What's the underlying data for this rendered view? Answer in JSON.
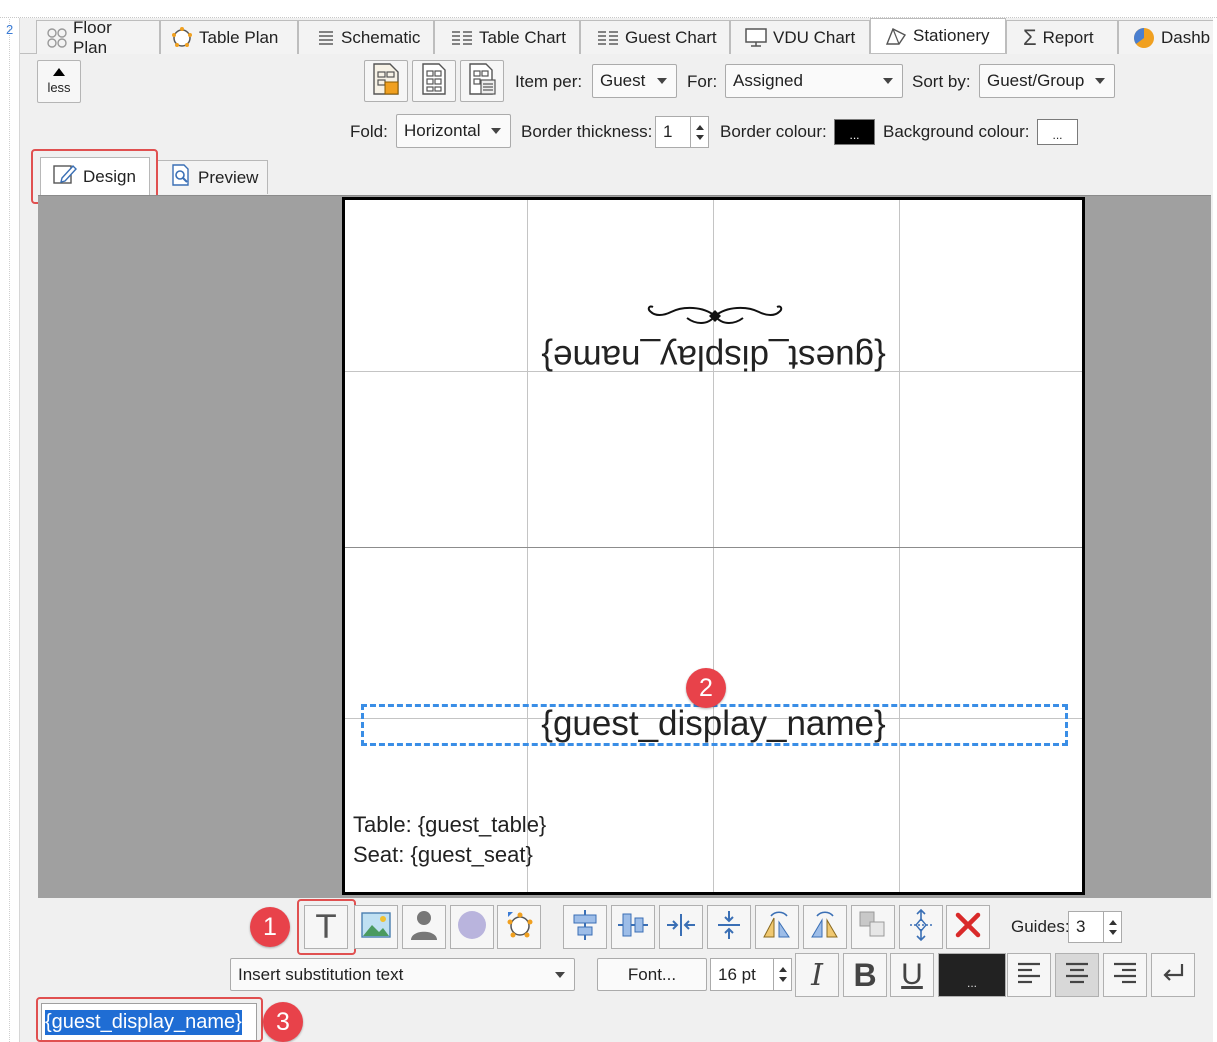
{
  "tabs": [
    {
      "label": "Floor Plan",
      "icon": "floor-plan-icon"
    },
    {
      "label": "Table Plan",
      "icon": "table-plan-icon"
    },
    {
      "label": "Schematic",
      "icon": "schematic-icon"
    },
    {
      "label": "Table Chart",
      "icon": "table-chart-icon"
    },
    {
      "label": "Guest Chart",
      "icon": "guest-chart-icon"
    },
    {
      "label": "VDU Chart",
      "icon": "monitor-icon"
    },
    {
      "label": "Stationery",
      "icon": "stationery-icon",
      "active": true
    },
    {
      "label": "Report",
      "icon": "sigma-icon"
    },
    {
      "label": "Dashb",
      "icon": "pie-icon"
    }
  ],
  "left_edge_text": "2",
  "toolbar": {
    "less_label": "less",
    "item_per_label": "Item per:",
    "item_per_value": "Guest",
    "for_label": "For:",
    "for_value": "Assigned",
    "sort_by_label": "Sort by:",
    "sort_by_value": "Guest/Group",
    "fold_label": "Fold:",
    "fold_value": "Horizontal",
    "border_thickness_label": "Border thickness:",
    "border_thickness_value": "1",
    "border_colour_label": "Border colour:",
    "border_colour_btn": "...",
    "border_colour": "#000000",
    "background_colour_label": "Background colour:",
    "background_colour_btn": "...",
    "background_colour": "#ffffff"
  },
  "subtabs": {
    "design": "Design",
    "preview": "Preview"
  },
  "card": {
    "top_name": "{guest_display_name}",
    "bottom_name": "{guest_display_name}",
    "table_line": "Table: {guest_table}",
    "seat_line": "Seat: {guest_seat}"
  },
  "badges": {
    "one": "1",
    "two": "2",
    "three": "3"
  },
  "bottom_toolbar": {
    "guides_label": "Guides:",
    "guides_value": "3",
    "insert_text": "Insert substitution text",
    "font_btn": "Font...",
    "font_size": "16 pt",
    "italic": "I",
    "bold": "B",
    "underline": "U",
    "color_btn": "...",
    "text_color": "#222222"
  },
  "text_input_value": "{guest_display_name}",
  "accent": {
    "highlight_red": "#e05050",
    "badge_red": "#e8424a",
    "selection_blue": "#3a8ee6"
  }
}
